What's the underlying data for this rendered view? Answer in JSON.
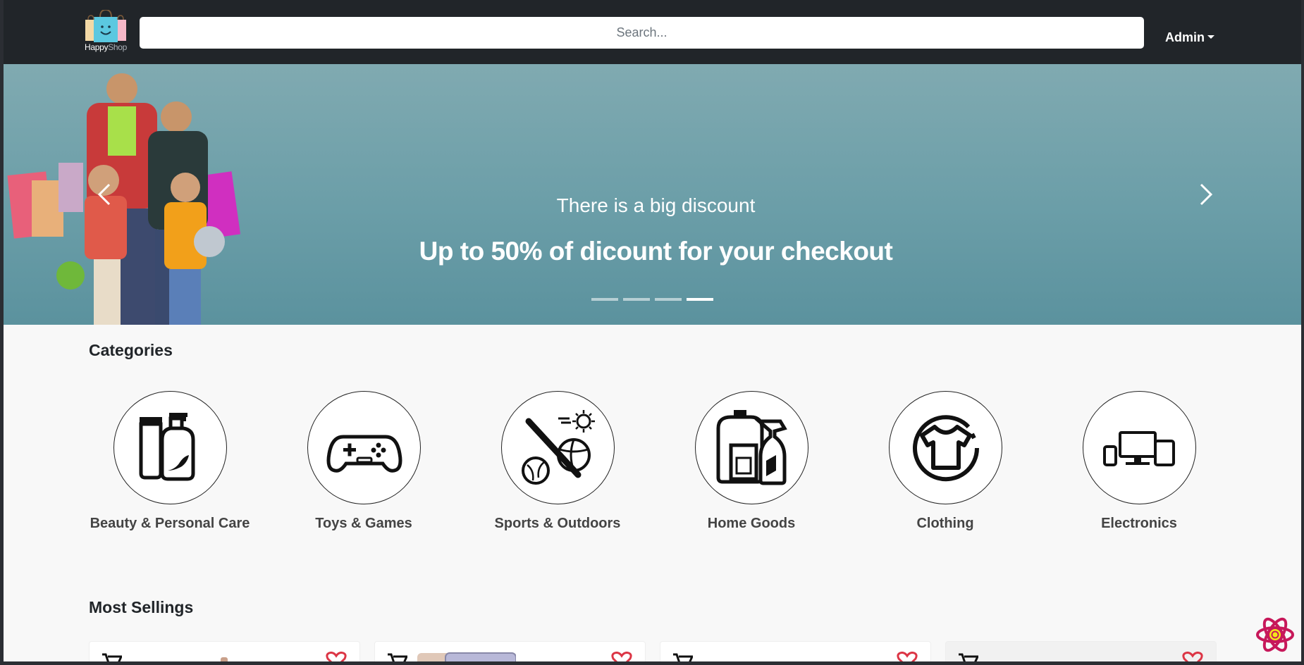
{
  "header": {
    "logo": {
      "text_happy": "Happy",
      "text_shop": "Shop"
    },
    "search": {
      "placeholder": "Search...",
      "value": ""
    },
    "user_menu": {
      "label": "Admin"
    }
  },
  "hero": {
    "subtitle": "There is a big discount",
    "title": "Up to 50% of dicount for your checkout",
    "slide_count": 4,
    "active_slide": 4,
    "prev_icon": "chevron-left-icon",
    "next_icon": "chevron-right-icon"
  },
  "categories": {
    "title": "Categories",
    "items": [
      {
        "label": "Beauty & Personal Care",
        "icon": "lotion-bottle-icon"
      },
      {
        "label": "Toys & Games",
        "icon": "gamepad-icon"
      },
      {
        "label": "Sports & Outdoors",
        "icon": "sports-balls-icon"
      },
      {
        "label": "Home Goods",
        "icon": "cleaning-supplies-icon"
      },
      {
        "label": "Clothing",
        "icon": "tshirt-icon"
      },
      {
        "label": "Electronics",
        "icon": "devices-icon"
      }
    ]
  },
  "most_sellings": {
    "title": "Most Sellings",
    "cards": [
      {
        "cart_icon": "cart-icon",
        "favorite_icon": "heart-icon"
      },
      {
        "cart_icon": "cart-icon",
        "favorite_icon": "heart-icon"
      },
      {
        "cart_icon": "cart-icon",
        "favorite_icon": "heart-icon"
      },
      {
        "cart_icon": "cart-icon",
        "favorite_icon": "heart-icon"
      }
    ]
  },
  "colors": {
    "topbar": "#212529",
    "hero_bg": "#6b9ea8",
    "heart": "#dc3545",
    "react_badge": "#c7185a"
  }
}
